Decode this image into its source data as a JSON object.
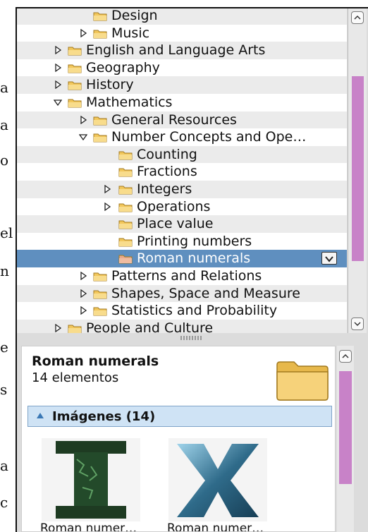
{
  "background_fragments": [
    "a",
    "a",
    "o",
    "el",
    "n",
    "e",
    "s",
    "a",
    "c"
  ],
  "tree": {
    "rows": [
      {
        "label": "Design",
        "has_expander": false,
        "expanded": false
      },
      {
        "label": "Music",
        "has_expander": true,
        "expanded": false
      },
      {
        "label": "English and Language Arts",
        "has_expander": true,
        "expanded": false
      },
      {
        "label": "Geography",
        "has_expander": true,
        "expanded": false
      },
      {
        "label": "History",
        "has_expander": true,
        "expanded": false
      },
      {
        "label": "Mathematics",
        "has_expander": true,
        "expanded": true
      },
      {
        "label": "General Resources",
        "has_expander": true,
        "expanded": false
      },
      {
        "label": "Number Concepts and Ope…",
        "has_expander": true,
        "expanded": true
      },
      {
        "label": "Counting",
        "has_expander": false,
        "expanded": false
      },
      {
        "label": "Fractions",
        "has_expander": false,
        "expanded": false
      },
      {
        "label": "Integers",
        "has_expander": true,
        "expanded": false
      },
      {
        "label": "Operations",
        "has_expander": true,
        "expanded": false
      },
      {
        "label": "Place value",
        "has_expander": false,
        "expanded": false
      },
      {
        "label": "Printing numbers",
        "has_expander": false,
        "expanded": false
      },
      {
        "label": "Roman numerals",
        "has_expander": false,
        "expanded": false,
        "selected": true
      },
      {
        "label": "Patterns and Relations",
        "has_expander": true,
        "expanded": false
      },
      {
        "label": "Shapes, Space and Measure",
        "has_expander": true,
        "expanded": false
      },
      {
        "label": "Statistics and Probability",
        "has_expander": true,
        "expanded": false
      },
      {
        "label": "People and Culture",
        "has_expander": true,
        "expanded": false
      }
    ]
  },
  "details": {
    "title": "Roman numerals",
    "count": "14 elementos",
    "section_label": "Imágenes (14)",
    "thumbnails": [
      {
        "glyph": "I",
        "caption": "Roman numer…"
      },
      {
        "glyph": "X",
        "caption": "Roman numer…"
      }
    ]
  },
  "colors": {
    "selection": "#5f8fbf",
    "scroll_thumb": "#c882c8",
    "section_bg": "#cfe3f5",
    "folder": "#f2c75c"
  },
  "icons": {
    "folder": "folder-icon",
    "expander_collapsed": "triangle-right-icon",
    "expander_expanded": "triangle-down-icon",
    "dropdown": "chevron-down-icon"
  }
}
